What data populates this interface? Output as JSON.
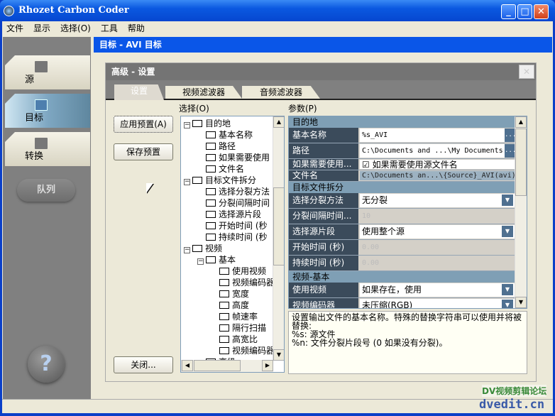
{
  "window": {
    "title": "Rhozet Carbon Coder"
  },
  "menu": [
    "文件",
    "显示",
    "选择(O)",
    "工具",
    "帮助"
  ],
  "nav": {
    "items": [
      "源",
      "目标",
      "转换"
    ],
    "queue": "队列",
    "help": "?"
  },
  "header": "目标 - AVI 目标",
  "panel": {
    "title": "高级 - 设置",
    "tabs": [
      "设置",
      "视频滤波器",
      "音频滤波器"
    ]
  },
  "buttons": {
    "apply": "应用预置(A)",
    "save": "保存预置",
    "close": "关闭..."
  },
  "tree": {
    "label": "选择(O)",
    "nodes": [
      {
        "t": "目的地",
        "lvl": 0,
        "exp": true
      },
      {
        "t": "基本名称",
        "lvl": 1
      },
      {
        "t": "路径",
        "lvl": 1
      },
      {
        "t": "如果需要使用",
        "lvl": 1
      },
      {
        "t": "文件名",
        "lvl": 1
      },
      {
        "t": "目标文件拆分",
        "lvl": 0,
        "exp": true
      },
      {
        "t": "选择分裂方法",
        "lvl": 1
      },
      {
        "t": "分裂间隔时间",
        "lvl": 1
      },
      {
        "t": "选择源片段",
        "lvl": 1
      },
      {
        "t": "开始时间 (秒",
        "lvl": 1
      },
      {
        "t": "持续时间 (秒",
        "lvl": 1
      },
      {
        "t": "视频",
        "lvl": 0,
        "exp": true
      },
      {
        "t": "基本",
        "lvl": 1,
        "exp": true
      },
      {
        "t": "使用视频",
        "lvl": 2
      },
      {
        "t": "视频编码器",
        "lvl": 2
      },
      {
        "t": "宽度",
        "lvl": 2
      },
      {
        "t": "高度",
        "lvl": 2
      },
      {
        "t": "帧速率",
        "lvl": 2
      },
      {
        "t": "隔行扫描",
        "lvl": 2
      },
      {
        "t": "高宽比",
        "lvl": 2
      },
      {
        "t": "视频编码器",
        "lvl": 2
      },
      {
        "t": "高级",
        "lvl": 1,
        "exp": true
      }
    ]
  },
  "params": {
    "label": "参数(P)",
    "rows": [
      {
        "section": "目的地"
      },
      {
        "k": "基本名称",
        "v": "%s_AVI",
        "type": "edit"
      },
      {
        "k": "路径",
        "v": "C:\\Documents and ...\\My Documents",
        "type": "edit"
      },
      {
        "k": "如果需要使用...",
        "v": "如果需要使用源文件名",
        "type": "check",
        "checked": true
      },
      {
        "k": "文件名",
        "v": "C:\\Documents an...\\{Source}_AVI(avi)",
        "type": "ro"
      },
      {
        "section": "目标文件拆分"
      },
      {
        "k": "选择分裂方法",
        "v": "无分裂",
        "type": "dd"
      },
      {
        "k": "分裂间隔时间...",
        "v": "10",
        "type": "dis"
      },
      {
        "k": "选择源片段",
        "v": "使用整个源",
        "type": "dd"
      },
      {
        "k": "开始时间 (秒)",
        "v": "0.00",
        "type": "dis"
      },
      {
        "k": "持续时间 (秒)",
        "v": "0.00",
        "type": "dis"
      },
      {
        "section": "视频-基本"
      },
      {
        "k": "使用视频",
        "v": "如果存在，使用",
        "type": "dd"
      },
      {
        "k": "视频编码器",
        "v": "未压缩(RGB)",
        "type": "dd"
      }
    ]
  },
  "description": [
    "设置输出文件的基本名称。特殊的替换字符串可以使用并将被替换:",
    "%s: 源文件",
    "%n: 文件分裂片段号 (0 如果没有分裂)。"
  ],
  "watermark": {
    "line1": "DV视频剪辑论坛",
    "line2": "dvedit.cn"
  }
}
